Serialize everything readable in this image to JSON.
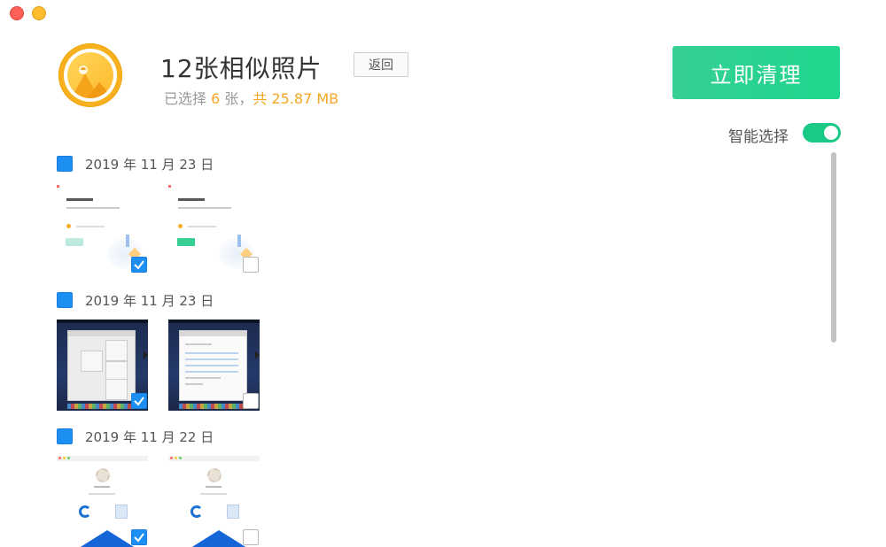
{
  "header": {
    "title": "12张相似照片",
    "back_label": "返回",
    "summary_prefix": "已选择 ",
    "selected_count": "6",
    "summary_unit": " 张，",
    "total_prefix": "共 ",
    "total_size": "25.87 MB"
  },
  "actions": {
    "clean_label": "立即清理",
    "smart_select_label": "智能选择",
    "smart_select_on": true
  },
  "colors": {
    "accent_green": "#1ed68c",
    "highlight_orange": "#f5a623",
    "checkbox_blue": "#1e8ff2"
  },
  "groups": [
    {
      "date": "2019 年 11 月 23 日",
      "checked": true,
      "photos": [
        {
          "checked": true
        },
        {
          "checked": false
        }
      ]
    },
    {
      "date": "2019 年 11 月 23 日",
      "checked": true,
      "photos": [
        {
          "checked": true
        },
        {
          "checked": false
        }
      ]
    },
    {
      "date": "2019 年 11 月 22 日",
      "checked": true,
      "photos": [
        {
          "checked": true
        },
        {
          "checked": false
        }
      ]
    }
  ]
}
